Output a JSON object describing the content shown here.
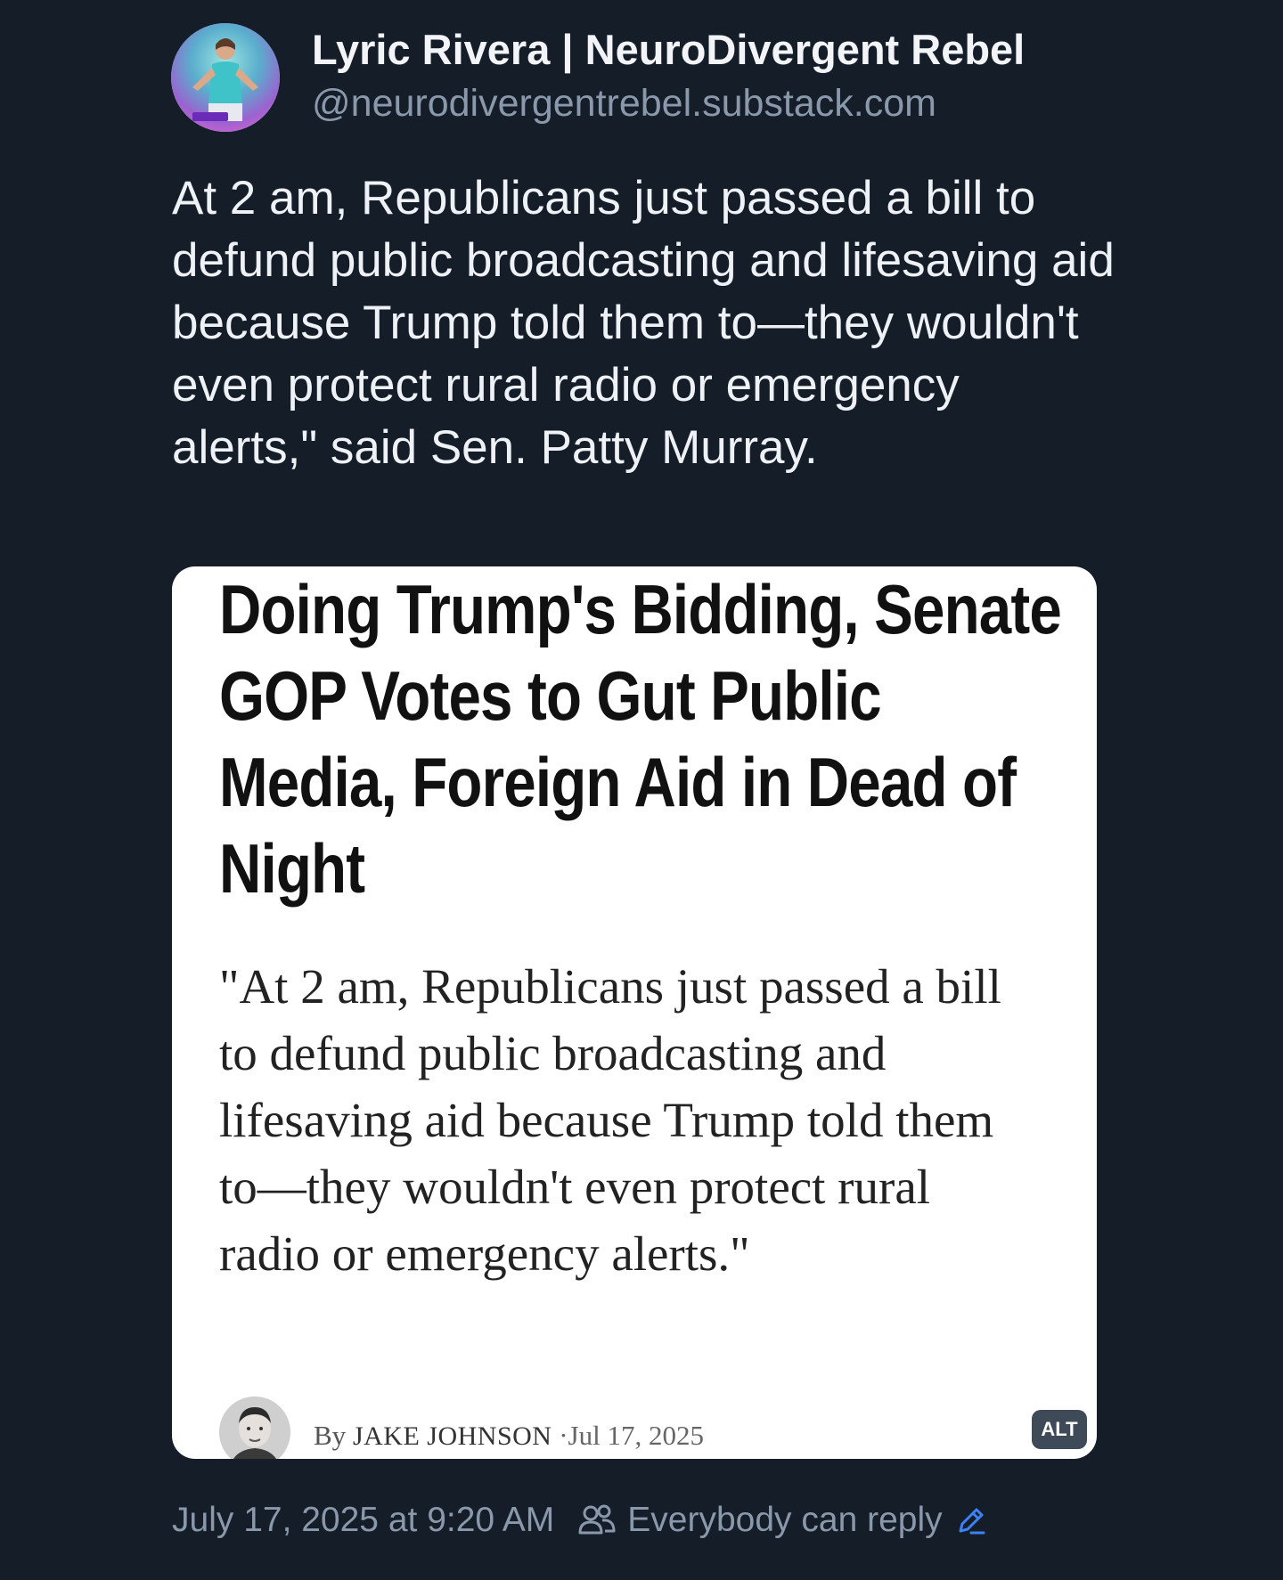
{
  "author": {
    "display_name": "Lyric Rivera | NeuroDivergent Rebel",
    "handle": "@neurodivergentrebel.substack.com",
    "avatar_caption": "Lyric Rivera"
  },
  "post": {
    "text": "At 2 am, Republicans just passed a bill to defund public broadcasting and lifesaving aid because Trump told them to—they wouldn't even protect rural radio or emergency alerts,\" said Sen. Patty Murray."
  },
  "image_card": {
    "headline": "Doing Trump's Bidding, Senate GOP Votes to Gut Public Media, Foreign Aid in Dead of Night",
    "quote": "\"At 2 am, Republicans just passed a bill to defund public broadcasting and lifesaving aid because Trump told them to—they wouldn't even protect rural radio or emergency alerts.\"",
    "by_prefix": "By",
    "author_name": "JAKE JOHNSON",
    "date": "·Jul 17, 2025",
    "alt_label": "ALT"
  },
  "footer": {
    "timestamp": "July 17, 2025 at 9:20 AM",
    "reply_setting": "Everybody can reply"
  },
  "colors": {
    "background": "#141d28",
    "accent": "#3b82f6",
    "muted_text": "#8a98ab"
  },
  "icons": [
    "people-icon",
    "edit-icon"
  ]
}
